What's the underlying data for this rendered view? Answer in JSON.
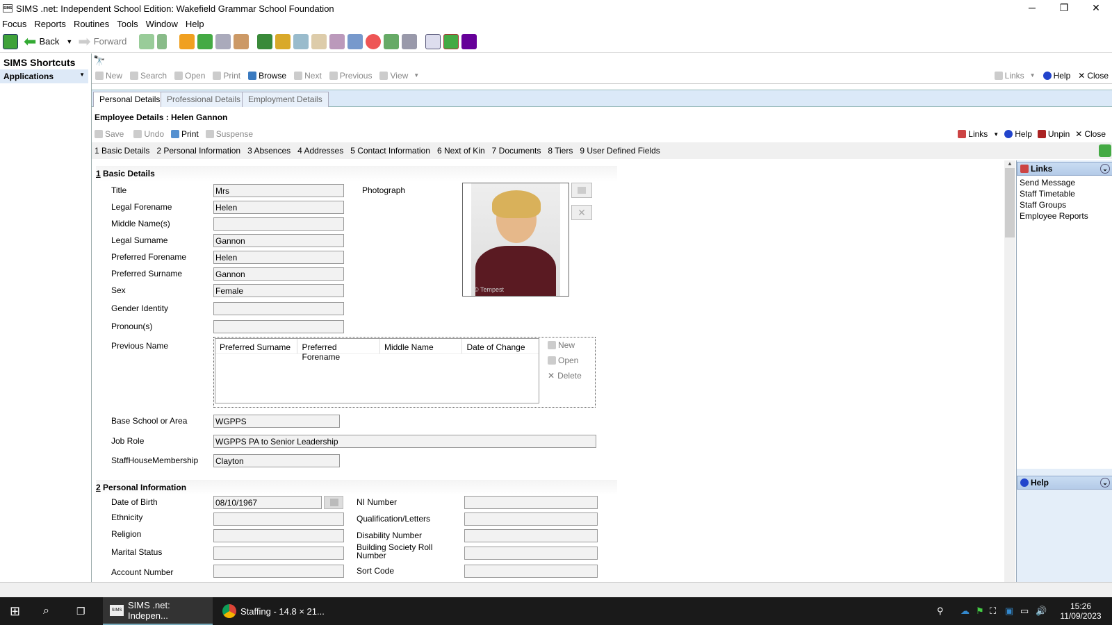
{
  "window": {
    "title": "SIMS .net: Independent School Edition: Wakefield Grammar School Foundation",
    "min": "─",
    "max": "❐",
    "close": "✕"
  },
  "menu": [
    "Focus",
    "Reports",
    "Routines",
    "Tools",
    "Window",
    "Help"
  ],
  "toolbar": {
    "back": "Back",
    "forward": "Forward"
  },
  "sidebar": {
    "heading": "SIMS Shortcuts",
    "applications": "Applications"
  },
  "cmdbar": {
    "new": "New",
    "search": "Search",
    "open": "Open",
    "print": "Print",
    "browse": "Browse",
    "next": "Next",
    "previous": "Previous",
    "view": "View",
    "links": "Links",
    "help": "Help",
    "close": "Close"
  },
  "tabs": [
    "Personal Details",
    "Professional Details",
    "Employment Details"
  ],
  "employee_header": "Employee Details : Helen Gannon",
  "recbar": {
    "save": "Save",
    "undo": "Undo",
    "print": "Print",
    "suspense": "Suspense",
    "links": "Links",
    "help": "Help",
    "unpin": "Unpin",
    "close": "Close"
  },
  "sections_nav": [
    "1 Basic Details",
    "2 Personal Information",
    "3 Absences",
    "4 Addresses",
    "5 Contact Information",
    "6 Next of Kin",
    "7 Documents",
    "8 Tiers",
    "9 User Defined Fields"
  ],
  "basic": {
    "heading_num": "1",
    "heading": "Basic Details",
    "title_label": "Title",
    "title": "Mrs",
    "legal_forename_label": "Legal Forename",
    "legal_forename": "Helen",
    "middle_label": "Middle Name(s)",
    "middle": "",
    "legal_surname_label": "Legal Surname",
    "legal_surname": "Gannon",
    "pref_forename_label": "Preferred Forename",
    "pref_forename": "Helen",
    "pref_surname_label": "Preferred Surname",
    "pref_surname": "Gannon",
    "sex_label": "Sex",
    "sex": "Female",
    "gender_label": "Gender Identity",
    "gender": "",
    "pronoun_label": "Pronoun(s)",
    "pronoun": "",
    "photo_label": "Photograph",
    "photo_credit": "© Tempest",
    "prev_name_label": "Previous Name",
    "prev_cols": [
      "Preferred Surname",
      "Preferred Forename",
      "Middle Name",
      "Date of Change"
    ],
    "prev_new": "New",
    "prev_open": "Open",
    "prev_delete": "Delete",
    "base_label": "Base School or Area",
    "base": "WGPPS",
    "role_label": "Job Role",
    "role": "WGPPS PA to Senior Leadership",
    "house_label": "StaffHouseMembership",
    "house": "Clayton"
  },
  "personal": {
    "heading_num": "2",
    "heading": "Personal Information",
    "dob_label": "Date of Birth",
    "dob": "08/10/1967",
    "eth_label": "Ethnicity",
    "religion_label": "Religion",
    "marital_label": "Marital Status",
    "account_label": "Account Number",
    "ni_label": "NI Number",
    "qual_label": "Qualification/Letters",
    "dis_label": "Disability Number",
    "bsrn_label": "Building Society Roll Number",
    "sort_label": "Sort Code"
  },
  "rightpanel": {
    "links_title": "Links",
    "links": [
      "Send Message",
      "Staff Timetable",
      "Staff Groups",
      "Employee Reports"
    ],
    "help_title": "Help"
  },
  "taskbar": {
    "app1": "SIMS .net: Indepen...",
    "app2": "Staffing - 14.8 × 21...",
    "time": "15:26",
    "date": "11/09/2023"
  }
}
